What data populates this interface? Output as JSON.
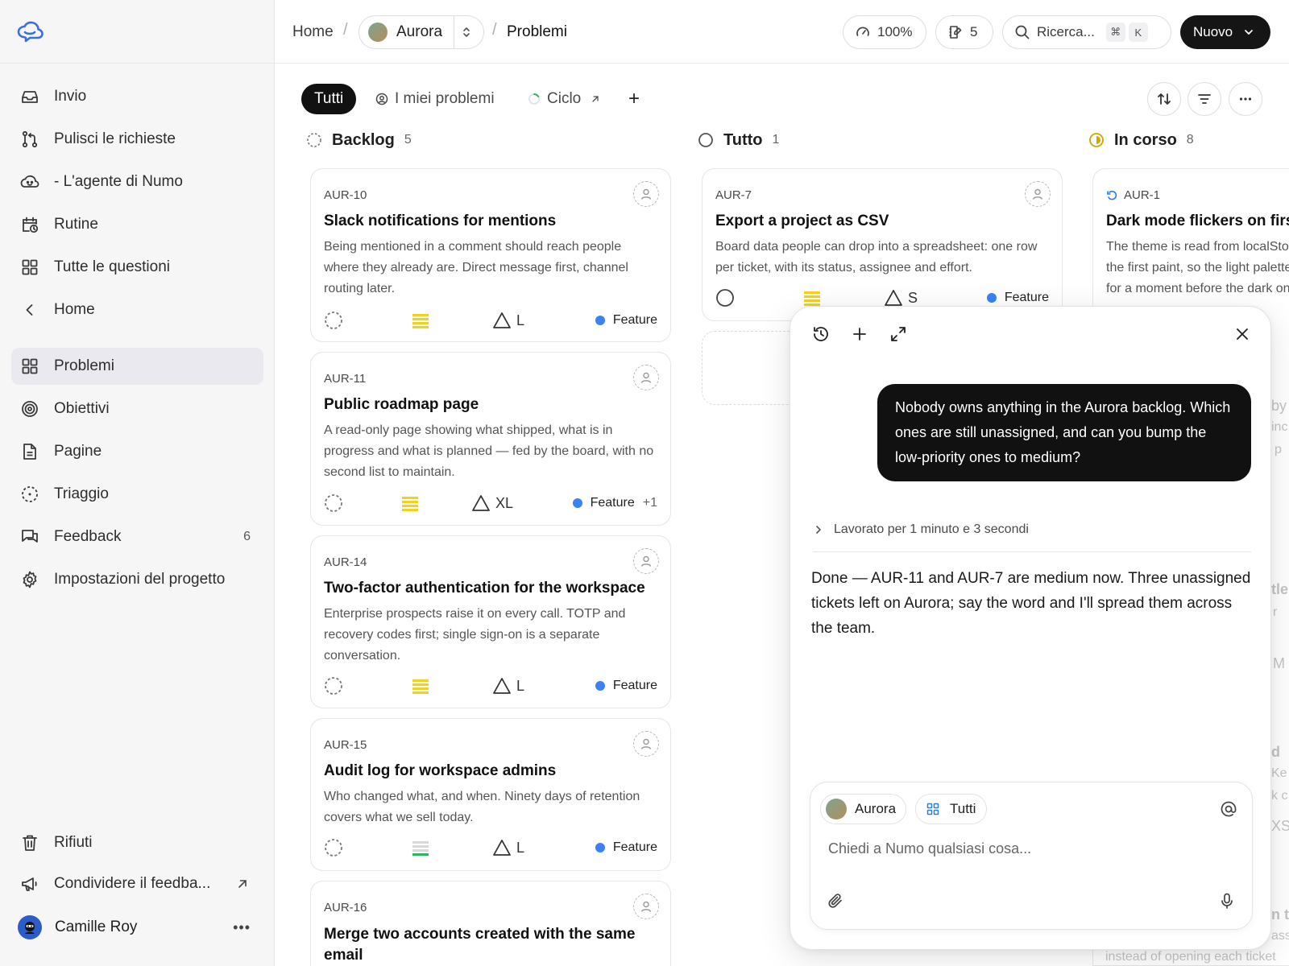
{
  "sidebar": {
    "items": [
      {
        "label": "Invio"
      },
      {
        "label": "Pulisci le richieste"
      },
      {
        "label": "- L'agente di Numo"
      },
      {
        "label": "Rutine"
      },
      {
        "label": "Tutte le questioni"
      },
      {
        "label": "Home"
      },
      {
        "label": "Problemi"
      },
      {
        "label": "Obiettivi"
      },
      {
        "label": "Pagine"
      },
      {
        "label": "Triaggio"
      },
      {
        "label": "Feedback",
        "count": "6"
      },
      {
        "label": "Impostazioni del progetto"
      }
    ],
    "trash_label": "Rifiuti",
    "share_label": "Condividere il feedba...",
    "user_name": "Camille Roy"
  },
  "topbar": {
    "home": "Home",
    "project": "Aurora",
    "page": "Problemi",
    "zoom": "100%",
    "drafts_count": "5",
    "search_label": "Ricerca...",
    "kbd_cmd": "⌘",
    "kbd_k": "K",
    "new_label": "Nuovo"
  },
  "tabs": {
    "all": "Tutti",
    "mine": "I miei problemi",
    "cycle": "Ciclo",
    "add": "+"
  },
  "columns": [
    {
      "name": "Backlog",
      "count": "5"
    },
    {
      "name": "Tutto",
      "count": "1"
    },
    {
      "name": "In corso",
      "count": "8"
    }
  ],
  "cards": [
    {
      "id": "AUR-10",
      "title": "Slack notifications for mentions",
      "desc": "Being mentioned in a comment should reach people where they already are. Direct message first, channel routing later.",
      "effort": "L",
      "label": "Feature",
      "extra": ""
    },
    {
      "id": "AUR-11",
      "title": "Public roadmap page",
      "desc": "A read-only page showing what shipped, what is in progress and what is planned — fed by the board, with no second list to maintain.",
      "effort": "XL",
      "label": "Feature",
      "extra": "+1"
    },
    {
      "id": "AUR-14",
      "title": "Two-factor authentication for the workspace",
      "desc": "Enterprise prospects raise it on every call. TOTP and recovery codes first; single sign-on is a separate conversation.",
      "effort": "L",
      "label": "Feature",
      "extra": ""
    },
    {
      "id": "AUR-15",
      "title": "Audit log for workspace admins",
      "desc": "Who changed what, and when. Ninety days of retention covers what we sell today.",
      "effort": "L",
      "label": "Feature",
      "extra": ""
    },
    {
      "id": "AUR-16",
      "title": "Merge two accounts created with the same email",
      "desc": "",
      "effort": "",
      "label": "",
      "extra": ""
    },
    {
      "id": "AUR-7",
      "title": "Export a project as CSV",
      "desc": "Board data people can drop into a spreadsheet: one row per ticket, with its status, assignee and effort.",
      "effort": "S",
      "label": "Feature",
      "extra": ""
    },
    {
      "id": "AUR-1",
      "title": "Dark mode flickers on first load",
      "desc": "The theme is read from localStorage after the first paint, so the light palette shows for a moment before the dark one takes over. Most visible on slow devices.",
      "effort": "",
      "label": "",
      "extra": ""
    }
  ],
  "ghost_texts": [
    "by",
    "inc",
    "p",
    "tle",
    "r",
    "M",
    "d",
    "Ke",
    "k c",
    "XS",
    "n t",
    "assi",
    "instead of opening each ticket"
  ],
  "chat": {
    "user_message": "Nobody owns anything in the Aurora backlog. Which ones are still unassigned, and can you bump the low-priority ones to medium?",
    "worked_label": "Lavorato per 1 minuto e 3 secondi",
    "reply": "Done — AUR-11 and AUR-7 are medium now. Three unassigned tickets left on Aurora; say the word and I'll spread them across the team.",
    "chip_project": "Aurora",
    "chip_scope": "Tutti",
    "placeholder": "Chiedi a Numo qualsiasi cosa..."
  },
  "colors": {
    "accent_blue": "#3a6fe0",
    "label_feature": "#3b82f6",
    "priority_yellow": "#f2d21b",
    "priority_green": "#2fb463",
    "in_progress": "#d4a400",
    "dark": "#111111"
  },
  "icons": {
    "logo": "cloud-chat-icon",
    "inbox": "inbox-icon",
    "pull": "git-pull-icon",
    "agent": "agent-face-icon",
    "routine": "calendar-clock-icon",
    "grid": "grid-icon",
    "back": "chevron-left-icon",
    "target": "target-icon",
    "page": "document-icon",
    "triage": "dashed-circle-icon",
    "feedback": "chat-bubbles-icon",
    "settings": "gear-icon",
    "trash": "trash-icon",
    "megaphone": "megaphone-icon"
  }
}
